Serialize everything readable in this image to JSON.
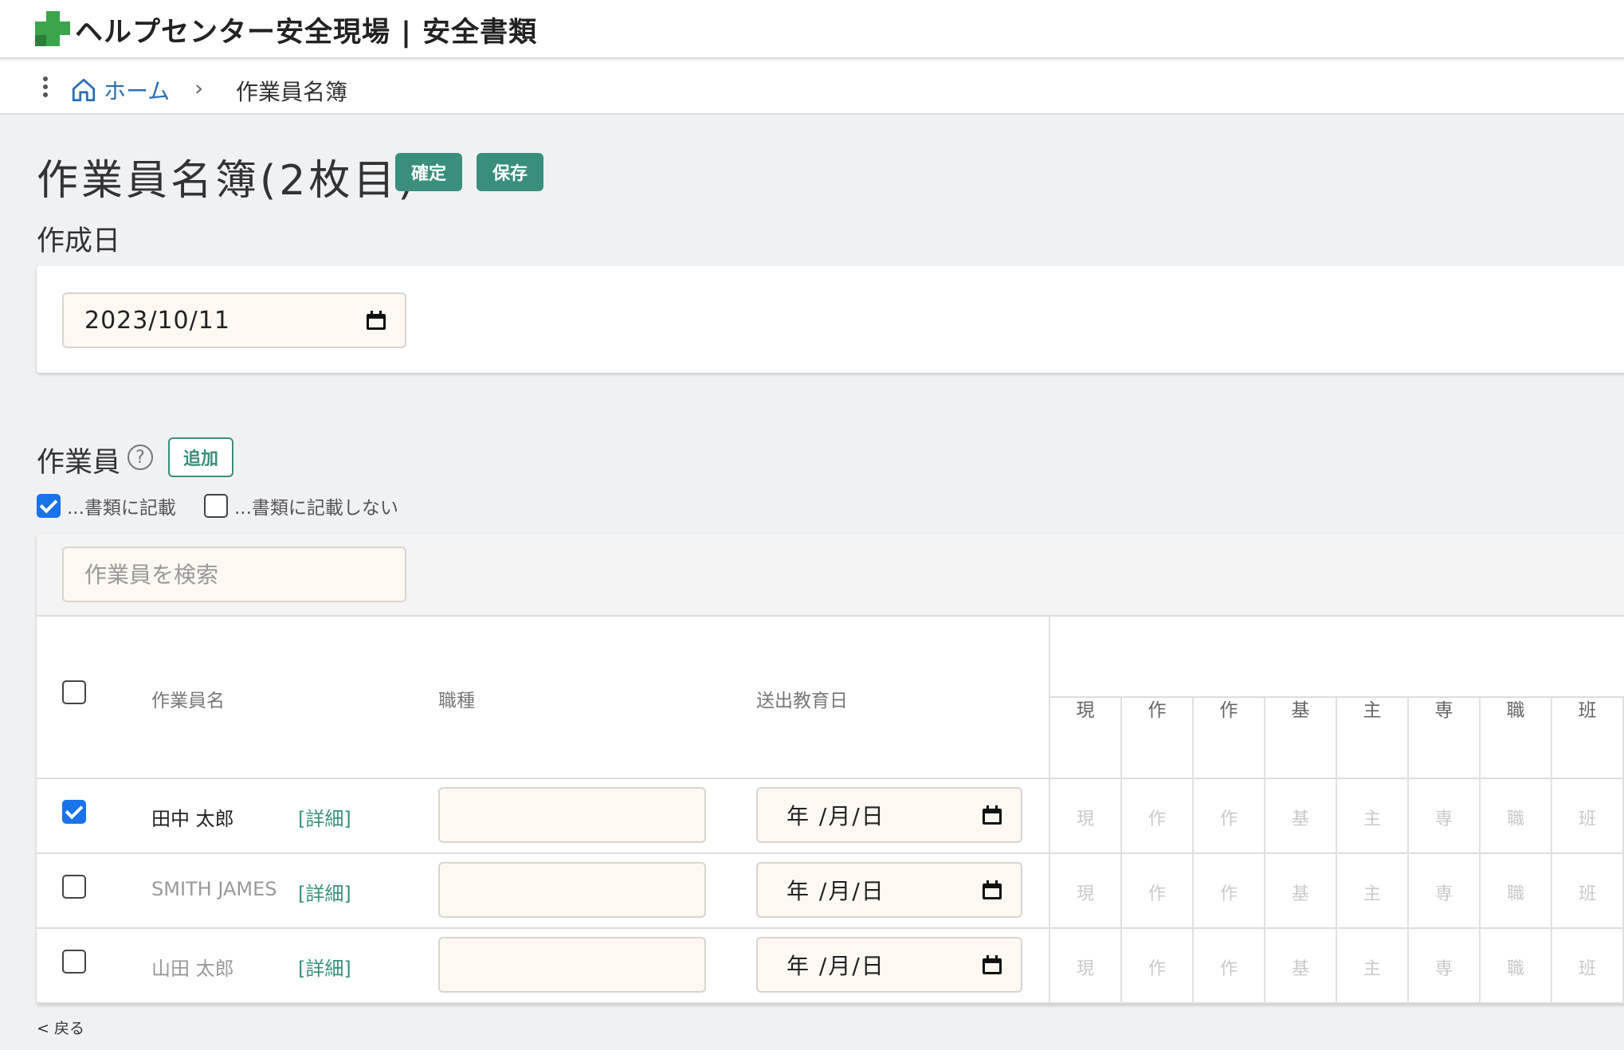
{
  "header": {
    "app_title": "ヘルプセンター安全現場 | 安全書類"
  },
  "breadcrumb": {
    "home": "ホーム",
    "separator": "›",
    "current": "作業員名簿"
  },
  "page": {
    "title": "作業員名簿(2枚目)",
    "confirm_label": "確定",
    "save_label": "保存"
  },
  "created": {
    "label": "作成日",
    "value": "2023/10/11"
  },
  "workers": {
    "label": "作業員",
    "help": "?",
    "add_label": "追加",
    "filter_include": "...書類に記載",
    "filter_include_checked": true,
    "filter_exclude": "...書類に記載しない",
    "filter_exclude_checked": false,
    "search_placeholder": "作業員を検索",
    "columns": {
      "name": "作業員名",
      "job": "職種",
      "education_date": "送出教育日"
    },
    "abbr_headers": [
      "現",
      "作",
      "作",
      "基",
      "主",
      "専",
      "職",
      "班"
    ],
    "rows": [
      {
        "name": "田中 太郎",
        "checked": true,
        "detail": "[詳細]",
        "job": "",
        "education_date": "年 /月/日",
        "abbr": [
          "現",
          "作",
          "作",
          "基",
          "主",
          "専",
          "職",
          "班"
        ]
      },
      {
        "name": "SMITH JAMES",
        "checked": false,
        "detail": "[詳細]",
        "job": "",
        "education_date": "年 /月/日",
        "abbr": [
          "現",
          "作",
          "作",
          "基",
          "主",
          "専",
          "職",
          "班"
        ]
      },
      {
        "name": "山田 太郎",
        "checked": false,
        "detail": "[詳細]",
        "job": "",
        "education_date": "年 /月/日",
        "abbr": [
          "現",
          "作",
          "作",
          "基",
          "主",
          "専",
          "職",
          "班"
        ]
      }
    ]
  },
  "footer": {
    "back": "< 戻る"
  },
  "colors": {
    "accent": "#3a8f7c",
    "link": "#2a6fb0",
    "checkbox": "#1a73e8",
    "input_bg": "#fdf8f1",
    "page_bg": "#f0f1f3",
    "logo_green": "#3aa54a"
  }
}
